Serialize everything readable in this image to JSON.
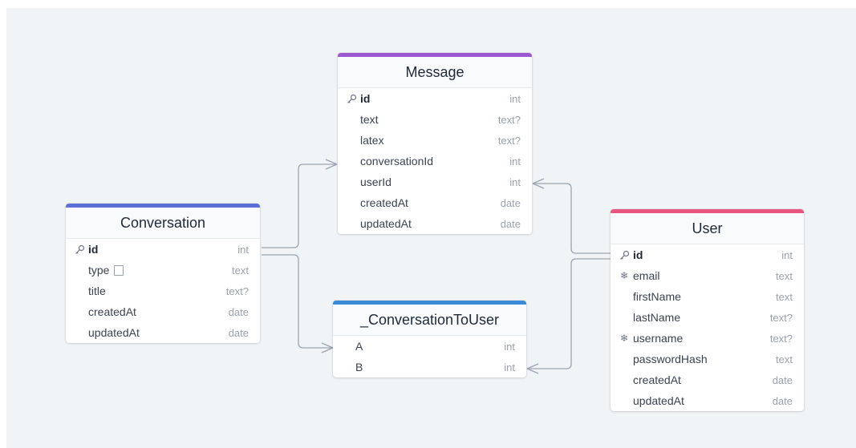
{
  "tables": {
    "message": {
      "title": "Message",
      "accent": "#9b59d0",
      "columns": [
        {
          "name": "id",
          "type": "int",
          "icon": "key-icon"
        },
        {
          "name": "text",
          "type": "text?"
        },
        {
          "name": "latex",
          "type": "text?"
        },
        {
          "name": "conversationId",
          "type": "int"
        },
        {
          "name": "userId",
          "type": "int"
        },
        {
          "name": "createdAt",
          "type": "date"
        },
        {
          "name": "updatedAt",
          "type": "date"
        }
      ]
    },
    "conversation": {
      "title": "Conversation",
      "accent": "#5b6fd6",
      "columns": [
        {
          "name": "id",
          "type": "int",
          "icon": "key-icon"
        },
        {
          "name": "type",
          "type": "text",
          "note": "note-icon"
        },
        {
          "name": "title",
          "type": "text?"
        },
        {
          "name": "createdAt",
          "type": "date"
        },
        {
          "name": "updatedAt",
          "type": "date"
        }
      ]
    },
    "conversation_to_user": {
      "title": "_ConversationToUser",
      "accent": "#3a8ad6",
      "columns": [
        {
          "name": "A",
          "type": "int"
        },
        {
          "name": "B",
          "type": "int"
        }
      ]
    },
    "user": {
      "title": "User",
      "accent": "#e8557f",
      "columns": [
        {
          "name": "id",
          "type": "int",
          "icon": "key-icon"
        },
        {
          "name": "email",
          "type": "text",
          "icon": "unique-icon"
        },
        {
          "name": "firstName",
          "type": "text"
        },
        {
          "name": "lastName",
          "type": "text?"
        },
        {
          "name": "username",
          "type": "text?",
          "icon": "unique-icon"
        },
        {
          "name": "passwordHash",
          "type": "text"
        },
        {
          "name": "createdAt",
          "type": "date"
        },
        {
          "name": "updatedAt",
          "type": "date"
        }
      ]
    }
  },
  "relations": [
    {
      "from": "conversation.id",
      "to": "message.conversationId"
    },
    {
      "from": "conversation.id",
      "to": "conversation_to_user.A"
    },
    {
      "from": "user.id",
      "to": "message.userId"
    },
    {
      "from": "user.id",
      "to": "conversation_to_user.B"
    }
  ],
  "colors": {
    "line": "#9aa3af",
    "background": "#f1f4f7"
  }
}
